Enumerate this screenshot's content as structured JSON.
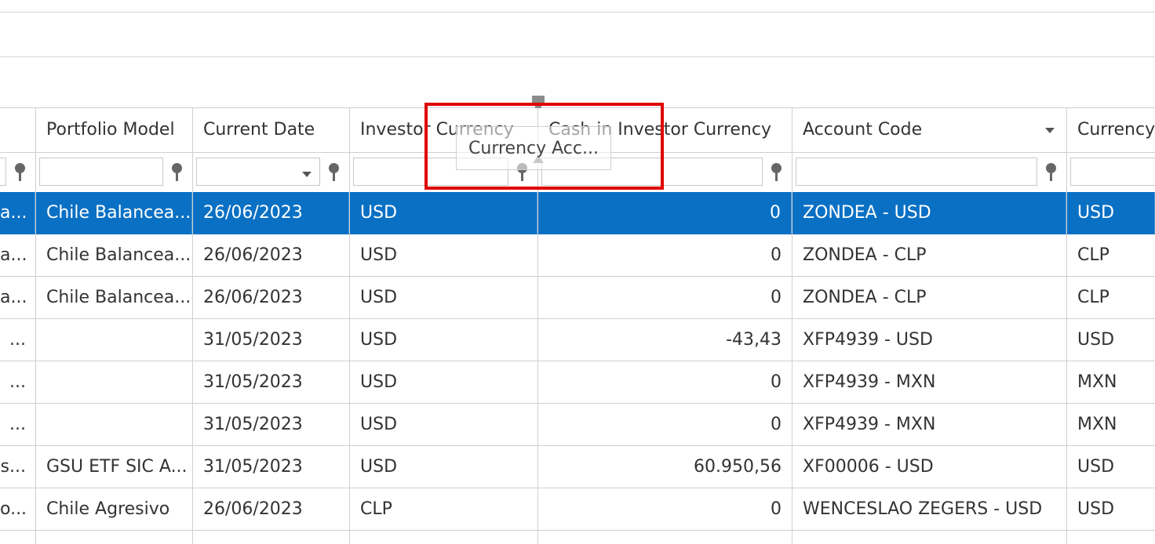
{
  "grid": {
    "columns": [
      {
        "key": "c0",
        "label": ""
      },
      {
        "key": "portfolio_model",
        "label": "Portfolio Model"
      },
      {
        "key": "current_date",
        "label": "Current Date"
      },
      {
        "key": "investor_currency",
        "label": "Investor Currency"
      },
      {
        "key": "cash_investor_currency",
        "label": "Cash in Investor Currency"
      },
      {
        "key": "account_code",
        "label": "Account Code"
      },
      {
        "key": "currency",
        "label": "Currency"
      }
    ],
    "rows": [
      {
        "c0": "a...",
        "portfolio_model": "Chile Balancea...",
        "current_date": "26/06/2023",
        "investor_currency": "USD",
        "cash_investor_currency": "0",
        "account_code": "ZONDEA - USD",
        "currency": "USD",
        "selected": true
      },
      {
        "c0": "a...",
        "portfolio_model": "Chile Balancea...",
        "current_date": "26/06/2023",
        "investor_currency": "USD",
        "cash_investor_currency": "0",
        "account_code": "ZONDEA - CLP",
        "currency": "CLP"
      },
      {
        "c0": "a...",
        "portfolio_model": "Chile Balancea...",
        "current_date": "26/06/2023",
        "investor_currency": "USD",
        "cash_investor_currency": "0",
        "account_code": "ZONDEA - CLP",
        "currency": "CLP"
      },
      {
        "c0": "...",
        "portfolio_model": "",
        "current_date": "31/05/2023",
        "investor_currency": "USD",
        "cash_investor_currency": "-43,43",
        "account_code": "XFP4939 - USD",
        "currency": "USD"
      },
      {
        "c0": "...",
        "portfolio_model": "",
        "current_date": "31/05/2023",
        "investor_currency": "USD",
        "cash_investor_currency": "0",
        "account_code": "XFP4939 - MXN",
        "currency": "MXN"
      },
      {
        "c0": "...",
        "portfolio_model": "",
        "current_date": "31/05/2023",
        "investor_currency": "USD",
        "cash_investor_currency": "0",
        "account_code": "XFP4939 - MXN",
        "currency": "MXN"
      },
      {
        "c0": "s...",
        "portfolio_model": "GSU ETF SIC A...",
        "current_date": "31/05/2023",
        "investor_currency": "USD",
        "cash_investor_currency": "60.950,56",
        "account_code": "XF00006 - USD",
        "currency": "USD"
      },
      {
        "c0": "o...",
        "portfolio_model": "Chile Agresivo",
        "current_date": "26/06/2023",
        "investor_currency": "CLP",
        "cash_investor_currency": "0",
        "account_code": "WENCESLAO ZEGERS - USD",
        "currency": "USD"
      }
    ]
  },
  "drag_ghost": {
    "label": "Currency Acc..."
  },
  "icons": {
    "filter": "filter-pin-icon",
    "dropdown": "dropdown-arrow-icon",
    "sort": "sort-desc-icon",
    "drop_marker": "drop-position-icon"
  },
  "colors": {
    "selection": "#0a70c4",
    "highlight": "#e00000"
  }
}
